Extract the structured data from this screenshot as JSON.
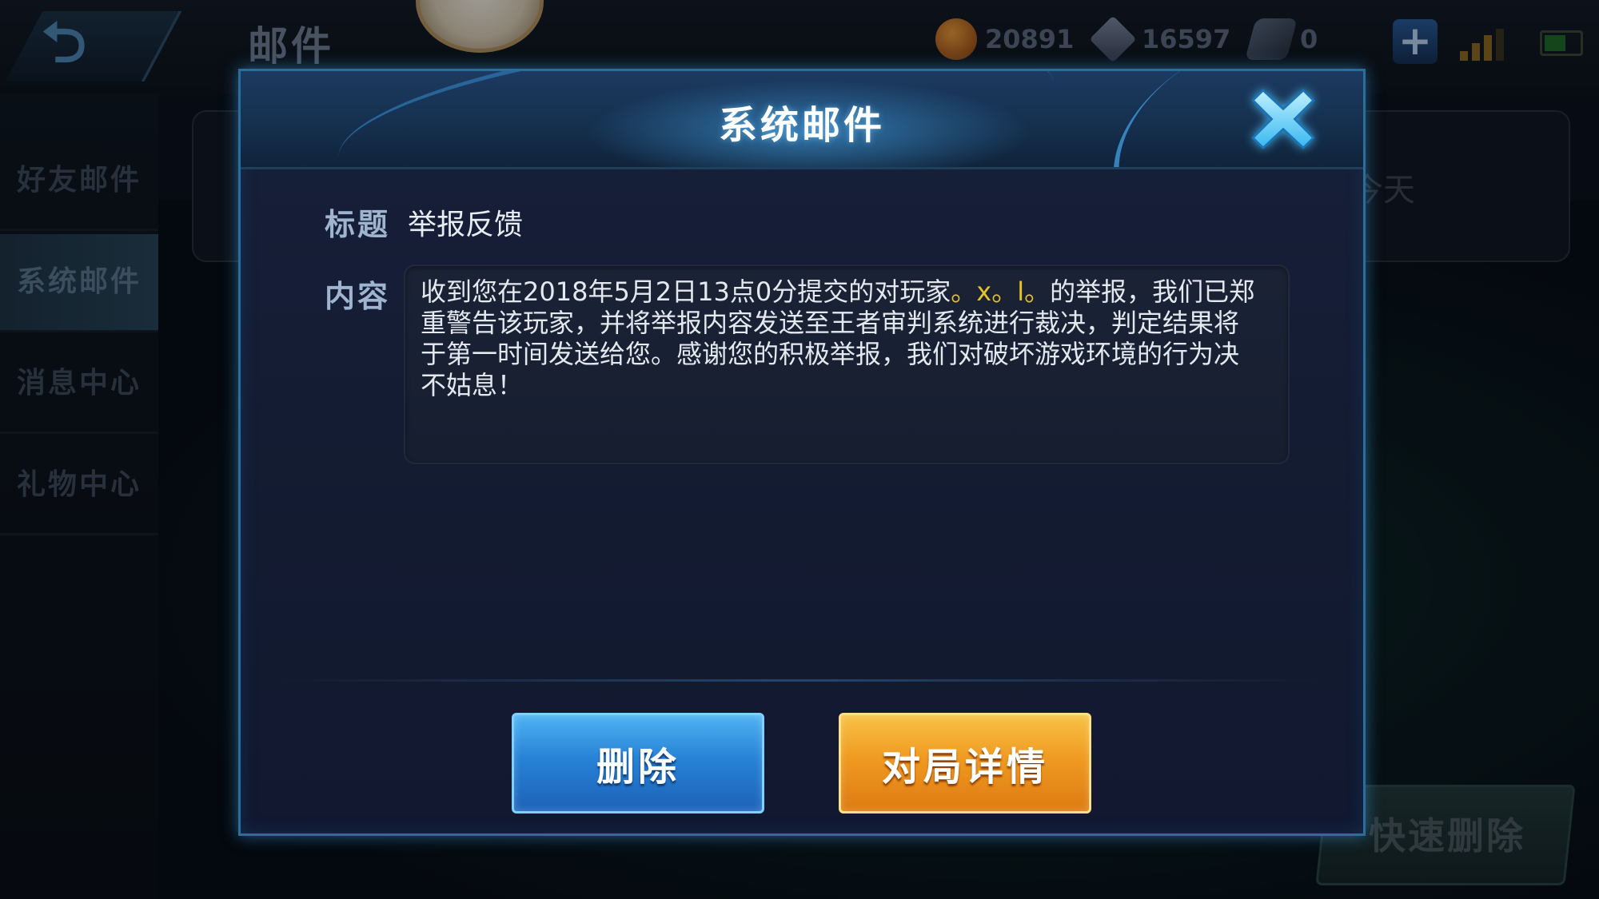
{
  "header": {
    "title": "邮件",
    "resources": [
      {
        "icon": "gold-coin-icon",
        "value": "20891"
      },
      {
        "icon": "diamond-icon",
        "value": "16597"
      },
      {
        "icon": "ticket-icon",
        "value": "0"
      }
    ]
  },
  "sidebar": {
    "items": [
      {
        "label": "好友邮件",
        "active": false
      },
      {
        "label": "系统邮件",
        "active": true
      },
      {
        "label": "消息中心",
        "active": false
      },
      {
        "label": "礼物中心",
        "active": false
      }
    ]
  },
  "background": {
    "mail_time_partial": "今天",
    "quick_delete_label": "快速删除"
  },
  "dialog": {
    "title": "系统邮件",
    "subject_label": "标题",
    "subject_value": "举报反馈",
    "content_label": "内容",
    "content_part1": "收到您在2018年5月2日13点0分提交的对玩家",
    "content_player": "。x。l。",
    "content_part2": "的举报，我们已郑重警告该玩家，并将举报内容发送至王者审判系统进行裁决，判定结果将于第一时间发送给您。感谢您的积极举报，我们对破坏游戏环境的行为决不姑息！",
    "delete_button": "删除",
    "detail_button": "对局详情"
  },
  "colors": {
    "highlight_player": "#e6c42a",
    "delete_button": "#2782d6",
    "detail_button": "#f09a21",
    "dialog_border": "#2d6d9b"
  }
}
